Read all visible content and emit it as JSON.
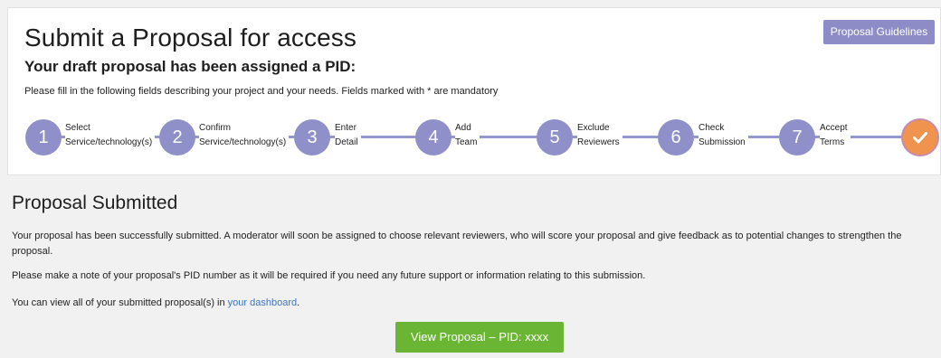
{
  "header": {
    "title": "Submit a Proposal for access",
    "guidelines_label": "Proposal Guidelines",
    "subtitle": "Your draft proposal has been assigned a PID:",
    "instructions": "Please fill in the following fields describing your project and your needs. Fields marked with * are mandatory"
  },
  "steps": [
    {
      "number": "1",
      "line1": "Select",
      "line2": "Service/technology(s)"
    },
    {
      "number": "2",
      "line1": "Confirm",
      "line2": "Service/technology(s)"
    },
    {
      "number": "3",
      "line1": "Enter",
      "line2": "Detail"
    },
    {
      "number": "4",
      "line1": "Add",
      "line2": "Team"
    },
    {
      "number": "5",
      "line1": "Exclude",
      "line2": "Reviewers"
    },
    {
      "number": "6",
      "line1": "Check",
      "line2": "Submission"
    },
    {
      "number": "7",
      "line1": "Accept",
      "line2": "Terms"
    }
  ],
  "final_step": {
    "icon": "check-icon",
    "state": "complete"
  },
  "result": {
    "title": "Proposal Submitted",
    "paragraph1": "Your proposal has been successfully submitted. A moderator will soon be assigned to choose relevant reviewers, who will score your proposal and give feedback as to potential changes to strengthen the proposal.",
    "paragraph2": "Please make a note of your proposal's PID number as it will be required if you need any future support or information relating to this submission.",
    "paragraph3_prefix": "You can view all of your submitted proposal(s) in ",
    "dashboard_link": "your dashboard",
    "paragraph3_suffix": ".",
    "view_button": "View Proposal – PID: xxxx"
  },
  "colors": {
    "step_accent": "#8f90c9",
    "final_step": "#f0934f",
    "primary_button": "#6ab533",
    "guidelines_button": "#8e8cc6",
    "link": "#3a75c4"
  }
}
